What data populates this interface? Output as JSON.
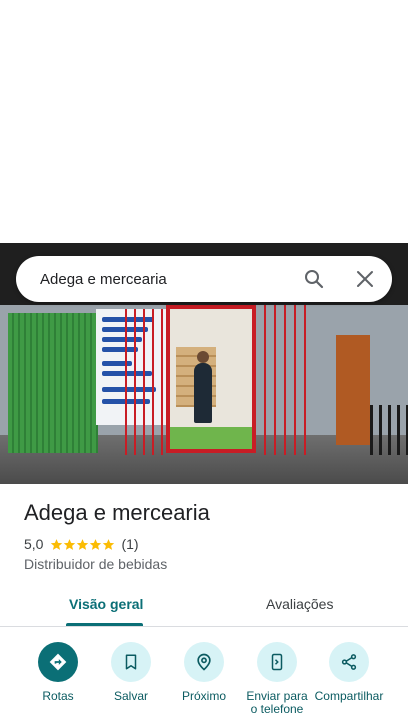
{
  "search": {
    "query": "Adega e mercearia"
  },
  "place": {
    "name": "Adega e mercearia",
    "rating": "5,0",
    "stars": 5,
    "review_count": "(1)",
    "category": "Distribuidor de bebidas"
  },
  "tabs": [
    {
      "label": "Visão geral",
      "active": true
    },
    {
      "label": "Avaliações",
      "active": false
    }
  ],
  "actions": [
    {
      "label": "Rotas",
      "icon": "directions-icon"
    },
    {
      "label": "Salvar",
      "icon": "bookmark-icon"
    },
    {
      "label": "Próximo",
      "icon": "nearby-icon"
    },
    {
      "label": "Enviar para o telefone",
      "icon": "send-to-phone-icon"
    },
    {
      "label": "Compartilhar",
      "icon": "share-icon"
    }
  ],
  "photo": {
    "poster_lines": [
      "TRABALHAMOS",
      "COM CHAVES",
      "PROTETOR",
      "SERVIÇOS",
      "PREÇOS",
      "PROMOCIONAIS",
      "Atendimento",
      "98252-3652"
    ]
  },
  "colors": {
    "accent": "#0b6f76",
    "accent_light": "#d7f3f6",
    "star": "#fbbc04"
  }
}
